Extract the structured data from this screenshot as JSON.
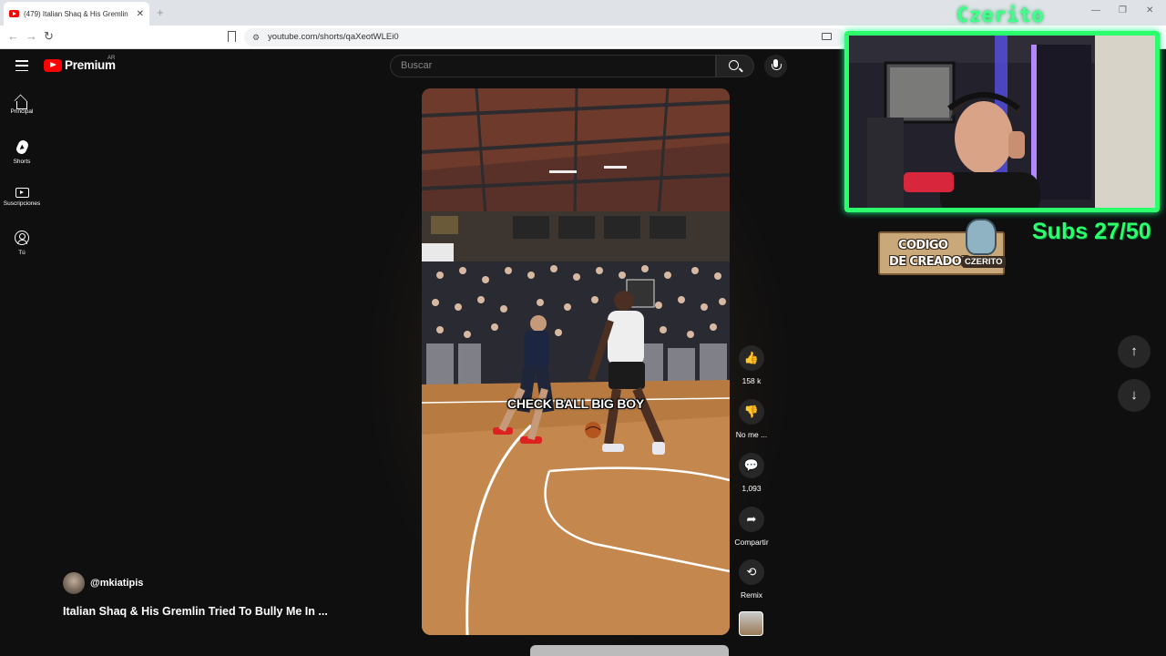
{
  "browser": {
    "tab_title": "(479) Italian Shaq & His Gremlin",
    "tab_close": "✕",
    "new_tab": "+",
    "url": "youtube.com/shorts/qaXeotWLEi0",
    "minimize": "—",
    "restore": "❐",
    "close": "✕",
    "back": "←",
    "forward": "→",
    "reload": "↻"
  },
  "youtube": {
    "logo_text": "Premium",
    "country_code": "AR",
    "search_placeholder": "Buscar",
    "sidebar": [
      {
        "label": "Principal",
        "icon": "home-icon"
      },
      {
        "label": "Shorts",
        "icon": "shorts-icon"
      },
      {
        "label": "Suscripciones",
        "icon": "subscriptions-icon"
      },
      {
        "label": "Tú",
        "icon": "you-icon"
      }
    ],
    "short": {
      "caption": "CHECK BALL BIG BOY",
      "channel_handle": "@mkiatipis",
      "title": "Italian Shaq & His Gremlin Tried To Bully Me In ..."
    },
    "actions": {
      "like_count": "158 k",
      "dislike_label": "No me ...",
      "comments_count": "1,093",
      "share_label": "Compartir",
      "remix_label": "Remix"
    },
    "nav_up": "↑",
    "nav_down": "↓"
  },
  "stream_overlay": {
    "name": "Czerito",
    "subs_goal": "Subs 27/50",
    "creator_code_line1": "CODIGO",
    "creator_code_line2": "DE CREADOR",
    "creator_code_tag": "CZERITO"
  },
  "colors": {
    "youtube_red": "#ff0000",
    "overlay_green": "#2bff6c",
    "page_bg": "#0f0f0f"
  }
}
